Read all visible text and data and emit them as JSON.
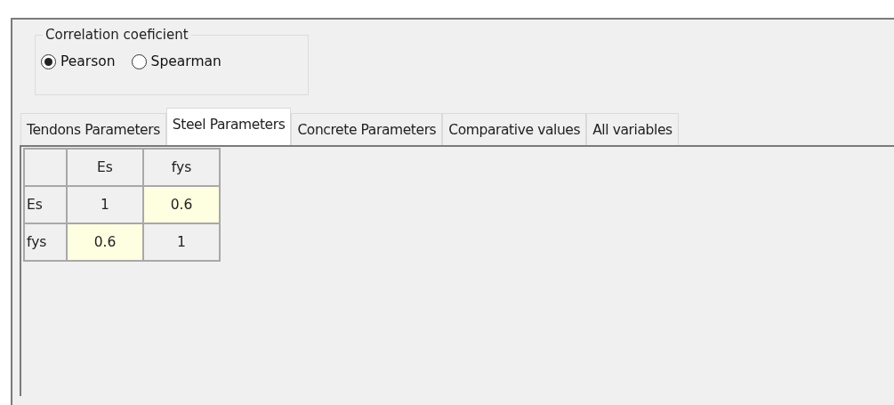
{
  "correlation": {
    "title": "Correlation coeficient",
    "options": [
      {
        "label": "Pearson",
        "selected": true
      },
      {
        "label": "Spearman",
        "selected": false
      }
    ]
  },
  "tabs": [
    {
      "label": "Tendons Parameters",
      "selected": false
    },
    {
      "label": "Steel Parameters",
      "selected": true
    },
    {
      "label": "Concrete Parameters",
      "selected": false
    },
    {
      "label": "Comparative values",
      "selected": false
    },
    {
      "label": "All variables",
      "selected": false
    }
  ],
  "table": {
    "columns": [
      "Es",
      "fys"
    ],
    "rows": [
      {
        "header": "Es",
        "cells": [
          {
            "value": "1",
            "highlighted": false
          },
          {
            "value": "0.6",
            "highlighted": true
          }
        ]
      },
      {
        "header": "fys",
        "cells": [
          {
            "value": "0.6",
            "highlighted": true
          },
          {
            "value": "1",
            "highlighted": false
          }
        ]
      }
    ]
  }
}
